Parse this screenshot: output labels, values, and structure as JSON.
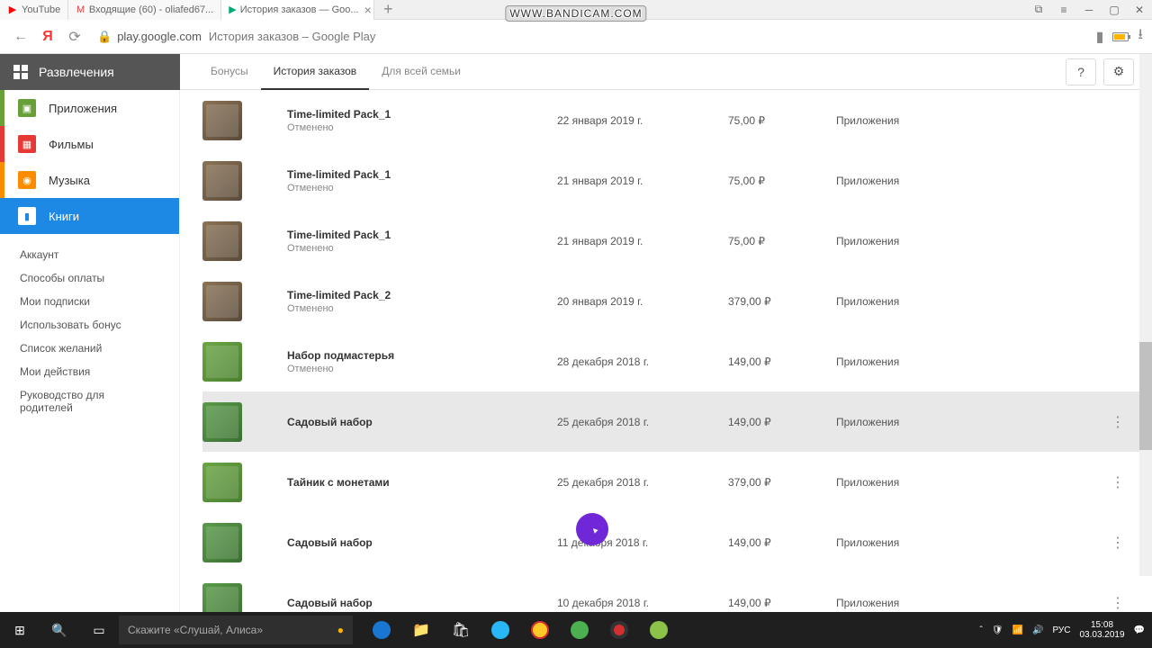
{
  "browser": {
    "tabs": [
      {
        "label": "YouTube"
      },
      {
        "label": "Входящие (60) - oliafed67..."
      },
      {
        "label": "История заказов — Goo..."
      }
    ],
    "url_domain": "play.google.com",
    "url_title": "История заказов – Google Play"
  },
  "watermark": "WWW.BANDICAM.COM",
  "play": {
    "entertainment": "Развлечения",
    "tabs": {
      "bonuses": "Бонусы",
      "history": "История заказов",
      "family": "Для всей семьи"
    }
  },
  "sidebar": {
    "cats": {
      "apps": "Приложения",
      "movies": "Фильмы",
      "music": "Музыка",
      "books": "Книги"
    },
    "links": [
      "Аккаунт",
      "Способы оплаты",
      "Мои подписки",
      "Использовать бонус",
      "Список желаний",
      "Мои действия",
      "Руководство для родителей"
    ]
  },
  "orders": [
    {
      "title": "Time-limited Pack_1",
      "status": "Отменено",
      "date": "22 января 2019 г.",
      "price": "75,00 ₽",
      "cat": "Приложения",
      "thumb": "sultan",
      "menu": false
    },
    {
      "title": "Time-limited Pack_1",
      "status": "Отменено",
      "date": "21 января 2019 г.",
      "price": "75,00 ₽",
      "cat": "Приложения",
      "thumb": "sultan",
      "menu": false
    },
    {
      "title": "Time-limited Pack_1",
      "status": "Отменено",
      "date": "21 января 2019 г.",
      "price": "75,00 ₽",
      "cat": "Приложения",
      "thumb": "sultan",
      "menu": false
    },
    {
      "title": "Time-limited Pack_2",
      "status": "Отменено",
      "date": "20 января 2019 г.",
      "price": "379,00 ₽",
      "cat": "Приложения",
      "thumb": "sultan",
      "menu": false
    },
    {
      "title": "Набор подмастерья",
      "status": "Отменено",
      "date": "28 декабря 2018 г.",
      "price": "149,00 ₽",
      "cat": "Приложения",
      "thumb": "game",
      "menu": false
    },
    {
      "title": "Садовый набор",
      "status": "",
      "date": "25 декабря 2018 г.",
      "price": "149,00 ₽",
      "cat": "Приложения",
      "thumb": "garden",
      "menu": true,
      "hover": true
    },
    {
      "title": "Тайник с монетами",
      "status": "",
      "date": "25 декабря 2018 г.",
      "price": "379,00 ₽",
      "cat": "Приложения",
      "thumb": "game",
      "menu": true
    },
    {
      "title": "Садовый набор",
      "status": "",
      "date": "11 декабря 2018 г.",
      "price": "149,00 ₽",
      "cat": "Приложения",
      "thumb": "garden",
      "menu": true
    },
    {
      "title": "Садовый набор",
      "status": "",
      "date": "10 декабря 2018 г.",
      "price": "149,00 ₽",
      "cat": "Приложения",
      "thumb": "garden",
      "menu": true
    }
  ],
  "taskbar": {
    "search_placeholder": "Скажите «Слушай, Алиса»",
    "lang": "РУС",
    "time": "15:08",
    "date": "03.03.2019"
  }
}
